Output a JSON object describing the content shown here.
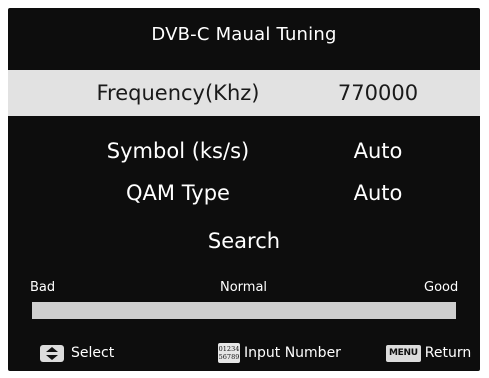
{
  "header": {
    "title": "DVB-C Maual Tuning"
  },
  "settings": [
    {
      "label": "Frequency(Khz)",
      "value": "770000",
      "selected": true
    },
    {
      "label": "Symbol (ks/s)",
      "value": "Auto",
      "selected": false
    },
    {
      "label": "QAM Type",
      "value": "Auto",
      "selected": false
    }
  ],
  "search": {
    "label": "Search"
  },
  "signal": {
    "bad": "Bad",
    "normal": "Normal",
    "good": "Good",
    "level": 0.0
  },
  "footer": {
    "select_label": "Select",
    "select_icon": "updown-arrows-icon",
    "number_icon_line1": "01234",
    "number_icon_line2": "56789",
    "input_label": "Input Number",
    "menu_icon_text": "MENU",
    "return_label": "Return"
  },
  "colors": {
    "panel": "#0d0d0d",
    "highlight": "#e2e2e2",
    "bar": "#cfcfcf"
  }
}
